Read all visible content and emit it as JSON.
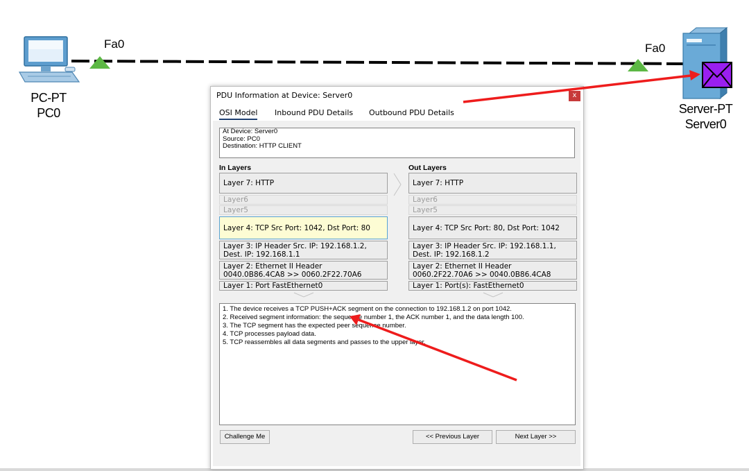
{
  "topology": {
    "pc": {
      "type_label": "PC-PT",
      "name_label": "PC0",
      "port_label": "Fa0"
    },
    "server": {
      "type_label": "Server-PT",
      "name_label": "Server0",
      "port_label": "Fa0"
    }
  },
  "dialog": {
    "title": "PDU Information at Device: Server0",
    "close_label": "x",
    "tabs": [
      "OSI Model",
      "Inbound PDU Details",
      "Outbound PDU Details"
    ],
    "active_tab": "OSI Model",
    "info": {
      "device": "At Device: Server0",
      "source": "Source: PC0",
      "destination": "Destination: HTTP CLIENT"
    },
    "in_layers": {
      "heading": "In Layers",
      "layer7": "Layer 7: HTTP",
      "layer6": "Layer6",
      "layer5": "Layer5",
      "layer4": "Layer 4: TCP Src Port: 1042, Dst Port: 80",
      "layer3_line1": "Layer 3: IP Header Src. IP: 192.168.1.2,",
      "layer3_line2": "Dest. IP: 192.168.1.1",
      "layer2_line1": "Layer 2: Ethernet II Header",
      "layer2_line2": "0040.0B86.4CA8 >> 0060.2F22.70A6",
      "layer1": "Layer 1: Port FastEthernet0"
    },
    "out_layers": {
      "heading": "Out Layers",
      "layer7": "Layer 7: HTTP",
      "layer6": "Layer6",
      "layer5": "Layer5",
      "layer4": "Layer 4: TCP Src Port: 80, Dst Port: 1042",
      "layer3_line1": "Layer 3: IP Header Src. IP: 192.168.1.1,",
      "layer3_line2": "Dest. IP: 192.168.1.2",
      "layer2_line1": "Layer 2: Ethernet II Header",
      "layer2_line2": "0060.2F22.70A6 >> 0040.0B86.4CA8",
      "layer1": "Layer 1: Port(s): FastEthernet0"
    },
    "steps": [
      "1. The device receives a TCP PUSH+ACK segment on the connection to 192.168.1.2 on port 1042.",
      "2. Received segment information: the sequence number 1, the ACK number 1, and the data length 100.",
      "3. The TCP segment has the expected peer sequence number.",
      "4. TCP processes payload data.",
      "5. TCP reassembles all data segments and passes to the upper layer."
    ],
    "buttons": {
      "challenge": "Challenge Me",
      "previous": "<< Previous Layer",
      "next": "Next Layer >>"
    }
  },
  "colors": {
    "link_triangle": "#5cb844",
    "envelope": "#9a1ff0",
    "annotation_arrow": "#ee1c1c",
    "active_layer_fill": "#fdfcd4",
    "active_layer_border": "#57a2d3"
  }
}
